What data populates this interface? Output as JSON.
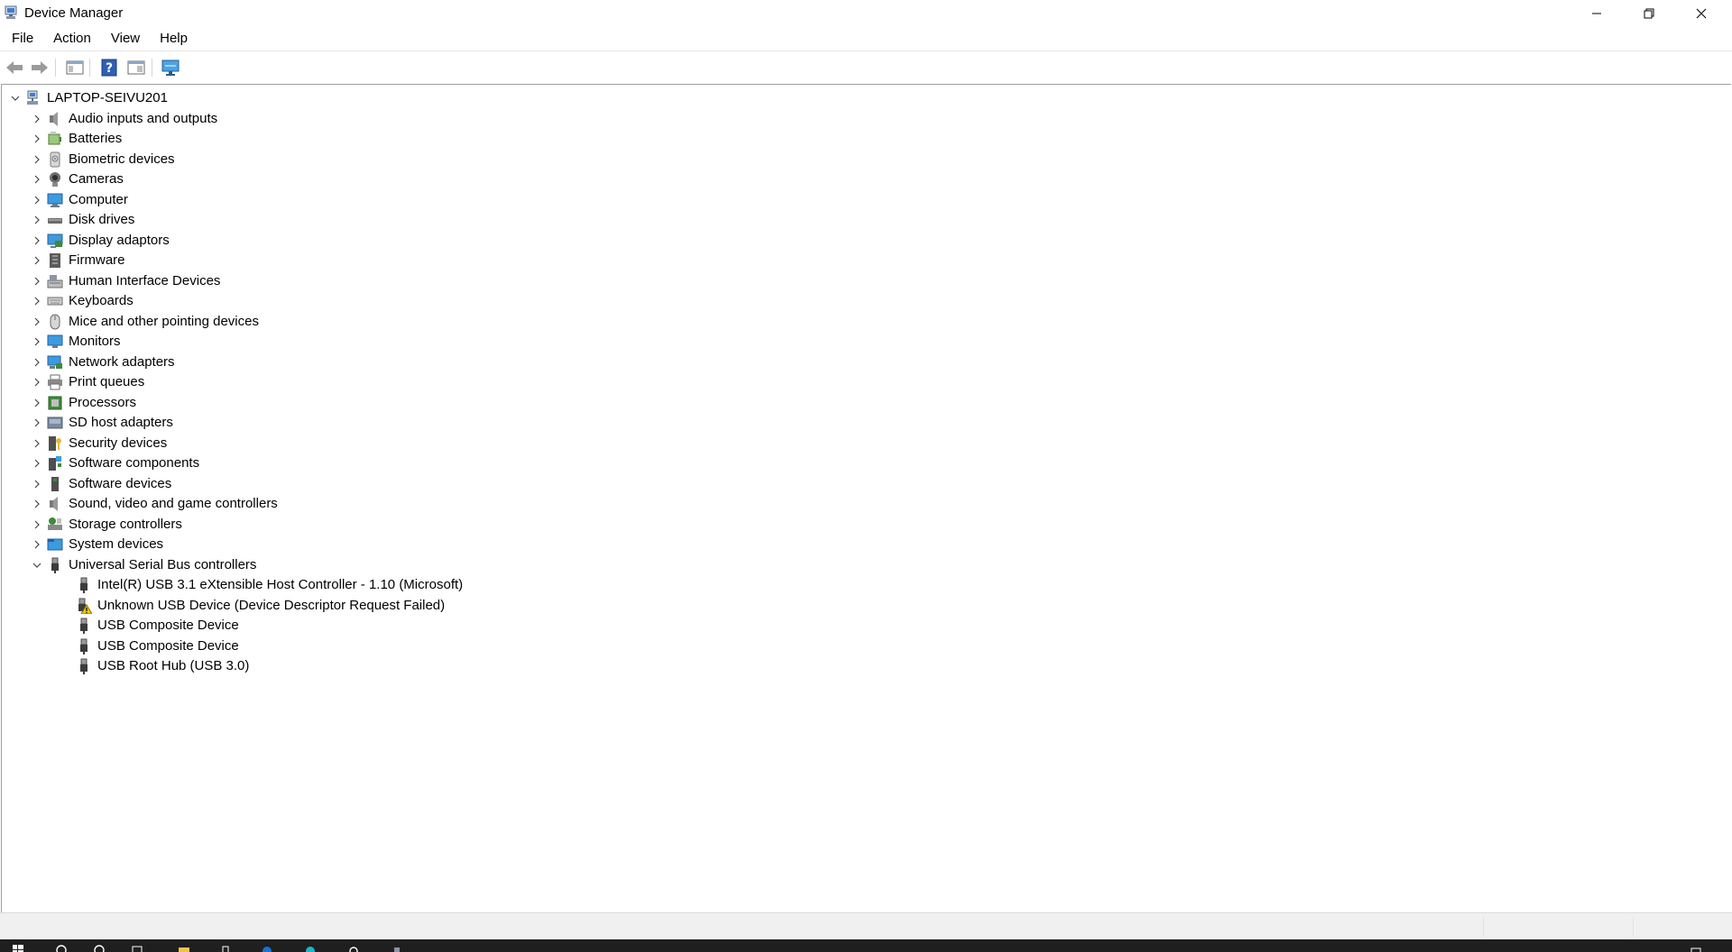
{
  "window": {
    "title": "Device Manager"
  },
  "menu": [
    "File",
    "Action",
    "View",
    "Help"
  ],
  "toolbar": {
    "buttons": [
      "back-arrow-icon",
      "forward-arrow-icon",
      "show-hide-console-tree-icon",
      "help-icon",
      "properties-pane-icon",
      "scan-hardware-monitor-icon"
    ]
  },
  "tree": {
    "root": "LAPTOP-SEIVU201",
    "categories": [
      {
        "label": "Audio inputs and outputs",
        "icon": "speaker-icon"
      },
      {
        "label": "Batteries",
        "icon": "battery-icon"
      },
      {
        "label": "Biometric devices",
        "icon": "fingerprint-icon"
      },
      {
        "label": "Cameras",
        "icon": "camera-icon"
      },
      {
        "label": "Computer",
        "icon": "computer-icon"
      },
      {
        "label": "Disk drives",
        "icon": "disk-drive-icon"
      },
      {
        "label": "Display adaptors",
        "icon": "display-adapter-icon"
      },
      {
        "label": "Firmware",
        "icon": "firmware-icon"
      },
      {
        "label": "Human Interface Devices",
        "icon": "hid-icon"
      },
      {
        "label": "Keyboards",
        "icon": "keyboard-icon"
      },
      {
        "label": "Mice and other pointing devices",
        "icon": "mouse-icon"
      },
      {
        "label": "Monitors",
        "icon": "monitor-icon"
      },
      {
        "label": "Network adapters",
        "icon": "network-adapter-icon"
      },
      {
        "label": "Print queues",
        "icon": "printer-icon"
      },
      {
        "label": "Processors",
        "icon": "processor-icon"
      },
      {
        "label": "SD host adapters",
        "icon": "sd-card-icon"
      },
      {
        "label": "Security devices",
        "icon": "security-key-icon"
      },
      {
        "label": "Software components",
        "icon": "software-component-icon"
      },
      {
        "label": "Software devices",
        "icon": "software-device-icon"
      },
      {
        "label": "Sound, video and game controllers",
        "icon": "speaker-icon"
      },
      {
        "label": "Storage controllers",
        "icon": "storage-controller-icon"
      },
      {
        "label": "System devices",
        "icon": "system-folder-icon"
      },
      {
        "label": "Universal Serial Bus controllers",
        "icon": "usb-plug-icon",
        "expanded": true
      }
    ],
    "usb_children": [
      {
        "label": "Intel(R) USB 3.1 eXtensible Host Controller - 1.10 (Microsoft)",
        "icon": "usb-plug-icon"
      },
      {
        "label": "Unknown USB Device (Device Descriptor Request Failed)",
        "icon": "usb-warning-icon"
      },
      {
        "label": "USB Composite Device",
        "icon": "usb-plug-icon"
      },
      {
        "label": "USB Composite Device",
        "icon": "usb-plug-icon"
      },
      {
        "label": "USB Root Hub (USB 3.0)",
        "icon": "usb-plug-icon"
      }
    ]
  },
  "colors": {
    "accent": "#0078d7",
    "warning": "#f5c400",
    "taskbar": "#1f1f1f",
    "statusbar": "#f0f0f0"
  }
}
